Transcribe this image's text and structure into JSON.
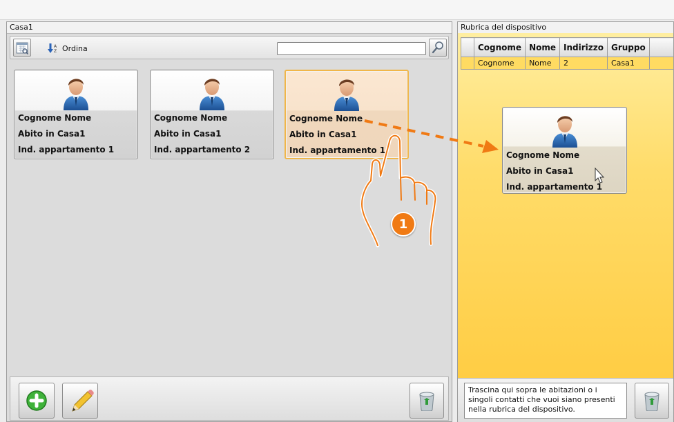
{
  "left_panel": {
    "title": "Casa1",
    "toolbar": {
      "sort_label": "Ordina",
      "search_value": ""
    },
    "cards": [
      {
        "name": "Cognome Nome",
        "home": "Abito in Casa1",
        "apartment": "Ind. appartamento 1"
      },
      {
        "name": "Cognome Nome",
        "home": "Abito in Casa1",
        "apartment": "Ind. appartamento 2"
      },
      {
        "name": "Cognome Nome",
        "home": "Abito in Casa1",
        "apartment": "Ind. appartamento 1"
      }
    ]
  },
  "right_panel": {
    "title": "Rubrica del dispositivo",
    "table": {
      "headers": [
        "Cognome",
        "Nome",
        "Indirizzo",
        "Gruppo"
      ],
      "rows": [
        {
          "cognome": "Cognome",
          "nome": "Nome",
          "indirizzo": "2",
          "gruppo": "Casa1"
        }
      ]
    },
    "hint": "Trascina qui sopra le abitazioni o i singoli contatti che vuoi siano presenti nella rubrica del dispositivo."
  },
  "drag_card": {
    "name": "Cognome Nome",
    "home": "Abito in Casa1",
    "apartment": "Ind. appartamento 1"
  },
  "step_badge": "1",
  "icons": [
    "calendar-icon",
    "sort-icon",
    "search-icon",
    "person-avatar-icon",
    "add-icon",
    "pencil-icon",
    "trash-icon",
    "hand-pointer-icon",
    "mouse-cursor-icon",
    "drag-arrow-icon"
  ],
  "colors": {
    "accent": "#f07a14",
    "selected_border": "#f0b64a",
    "drop_area": "#ffd04e"
  }
}
